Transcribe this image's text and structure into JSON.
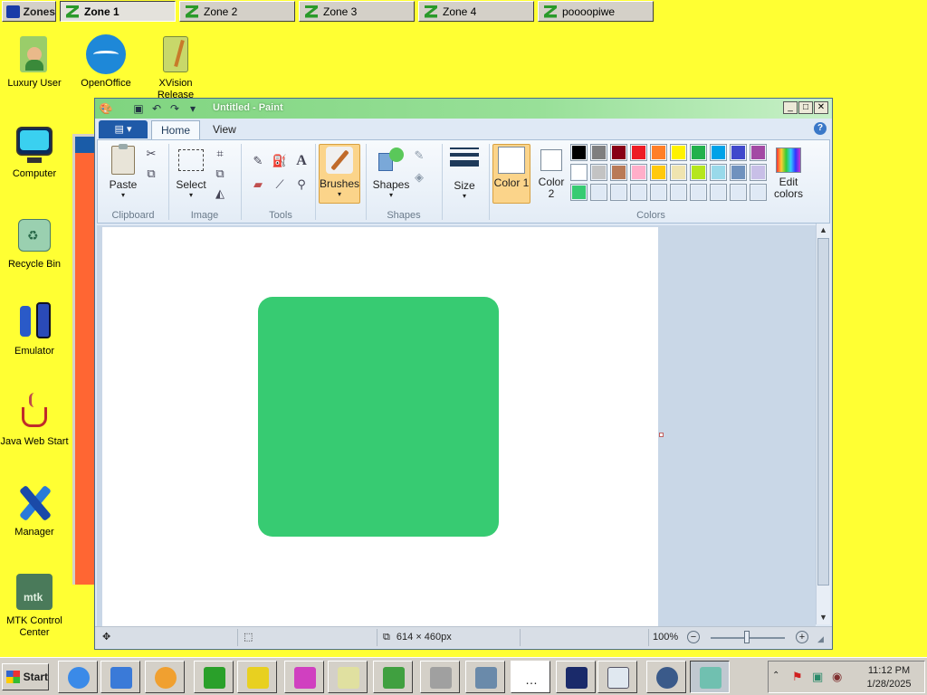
{
  "zonebar": {
    "label": "Zones",
    "zones": [
      {
        "label": "Zone 1"
      },
      {
        "label": "Zone 2"
      },
      {
        "label": "Zone 3"
      },
      {
        "label": "Zone 4"
      },
      {
        "label": "poooopiwe"
      }
    ]
  },
  "desktop": {
    "icons": [
      {
        "label": "Luxury User"
      },
      {
        "label": "OpenOffice"
      },
      {
        "label": "XVision Release"
      },
      {
        "label": "Computer"
      },
      {
        "label": "Recycle Bin"
      },
      {
        "label": "Emulator"
      },
      {
        "label": "Java Web Start"
      },
      {
        "label": "Manager"
      },
      {
        "label": "MTK Control Center"
      }
    ]
  },
  "paint": {
    "title": "Untitled - Paint",
    "tabs": {
      "home": "Home",
      "view": "View"
    },
    "ribbon": {
      "paste": "Paste",
      "select": "Select",
      "brushes": "Brushes",
      "shapes": "Shapes",
      "size": "Size",
      "color1": "Color 1",
      "color2": "Color 2",
      "edit_colors": "Edit colors",
      "groups": {
        "clipboard": "Clipboard",
        "image": "Image",
        "tools": "Tools",
        "shapes": "Shapes",
        "colors": "Colors"
      },
      "palette_row1": [
        "#000000",
        "#7f7f7f",
        "#880015",
        "#ed1c24",
        "#ff7f27",
        "#fff200",
        "#22b14c",
        "#00a2e8",
        "#3f48cc",
        "#a349a4"
      ],
      "palette_row2": [
        "#ffffff",
        "#c3c3c3",
        "#b97a57",
        "#ffaec9",
        "#ffc90e",
        "#efe4b0",
        "#b5e61d",
        "#99d9ea",
        "#7092be",
        "#c8bfe7"
      ],
      "palette_row3": [
        "#37cb72",
        "#dfe9f5",
        "#dfe9f5",
        "#dfe9f5",
        "#dfe9f5",
        "#dfe9f5",
        "#dfe9f5",
        "#dfe9f5",
        "#dfe9f5",
        "#dfe9f5"
      ],
      "color1_value": "#ffffff",
      "color2_value": "#ffffff"
    },
    "canvas": {
      "shape_color": "#37cb72"
    },
    "status": {
      "dimensions": "614 × 460px",
      "zoom": "100%"
    }
  },
  "taskbar": {
    "start": "Start",
    "clock_time": "11:12 PM",
    "clock_date": "1/28/2025"
  }
}
